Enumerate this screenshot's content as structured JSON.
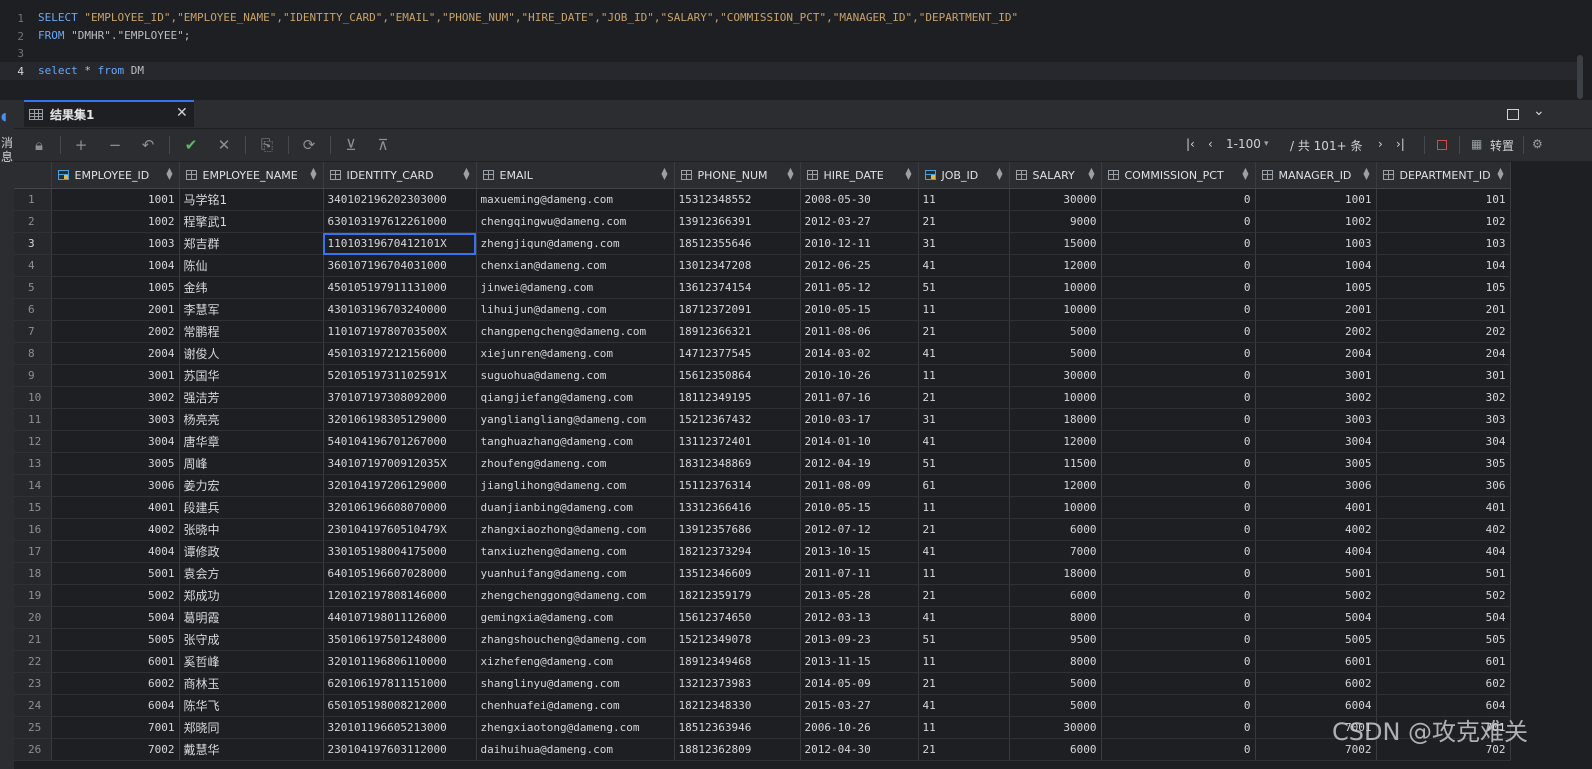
{
  "editor": {
    "lines": [
      {
        "n": "1",
        "parts": [
          {
            "t": "SELECT ",
            "c": "kw"
          },
          {
            "t": "\"EMPLOYEE_ID\",\"EMPLOYEE_NAME\",\"IDENTITY_CARD\",\"EMAIL\",\"PHONE_NUM\",\"HIRE_DATE\",\"JOB_ID\",\"SALARY\",\"COMMISSION_PCT\",\"MANAGER_ID\",\"DEPARTMENT_ID\"",
            "c": "str"
          }
        ]
      },
      {
        "n": "2",
        "parts": [
          {
            "t": "FROM ",
            "c": "kw"
          },
          {
            "t": "\"DMHR\".\"EMPLOYEE\";",
            "c": ""
          }
        ]
      },
      {
        "n": "3",
        "parts": []
      },
      {
        "n": "4",
        "parts": [
          {
            "t": "select",
            "c": "kw"
          },
          {
            "t": " * ",
            "c": ""
          },
          {
            "t": "from",
            "c": "kw"
          },
          {
            "t": " DM",
            "c": ""
          }
        ]
      }
    ]
  },
  "left_strip": {
    "label": "消息"
  },
  "result_tab": {
    "title": "结果集1"
  },
  "toolbar": {
    "page_range": "1-100",
    "total": "/ 共 101+ 条",
    "transpose_label": "转置"
  },
  "grid": {
    "columns": [
      "EMPLOYEE_ID",
      "EMPLOYEE_NAME",
      "IDENTITY_CARD",
      "EMAIL",
      "PHONE_NUM",
      "HIRE_DATE",
      "JOB_ID",
      "SALARY",
      "COMMISSION_PCT",
      "MANAGER_ID",
      "DEPARTMENT_ID"
    ],
    "rows": [
      [
        "1001",
        "马学铭1",
        "340102196202303000",
        "maxueming@dameng.com",
        "15312348552",
        "2008-05-30",
        "11",
        "30000",
        "0",
        "1001",
        "101"
      ],
      [
        "1002",
        "程擎武1",
        "630103197612261000",
        "chengqingwu@dameng.com",
        "13912366391",
        "2012-03-27",
        "21",
        "9000",
        "0",
        "1002",
        "102"
      ],
      [
        "1003",
        "郑吉群",
        "11010319670412101X",
        "zhengjiqun@dameng.com",
        "18512355646",
        "2010-12-11",
        "31",
        "15000",
        "0",
        "1003",
        "103"
      ],
      [
        "1004",
        "陈仙",
        "360107196704031000",
        "chenxian@dameng.com",
        "13012347208",
        "2012-06-25",
        "41",
        "12000",
        "0",
        "1004",
        "104"
      ],
      [
        "1005",
        "金纬",
        "450105197911131000",
        "jinwei@dameng.com",
        "13612374154",
        "2011-05-12",
        "51",
        "10000",
        "0",
        "1005",
        "105"
      ],
      [
        "2001",
        "李慧军",
        "430103196703240000",
        "lihuijun@dameng.com",
        "18712372091",
        "2010-05-15",
        "11",
        "10000",
        "0",
        "2001",
        "201"
      ],
      [
        "2002",
        "常鹏程",
        "11010719780703500X",
        "changpengcheng@dameng.com",
        "18912366321",
        "2011-08-06",
        "21",
        "5000",
        "0",
        "2002",
        "202"
      ],
      [
        "2004",
        "谢俊人",
        "450103197212156000",
        "xiejunren@dameng.com",
        "14712377545",
        "2014-03-02",
        "41",
        "5000",
        "0",
        "2004",
        "204"
      ],
      [
        "3001",
        "苏国华",
        "52010519731102591X",
        "suguohua@dameng.com",
        "15612350864",
        "2010-10-26",
        "11",
        "30000",
        "0",
        "3001",
        "301"
      ],
      [
        "3002",
        "强洁芳",
        "370107197308092000",
        "qiangjiefang@dameng.com",
        "18112349195",
        "2011-07-16",
        "21",
        "10000",
        "0",
        "3002",
        "302"
      ],
      [
        "3003",
        "杨亮亮",
        "320106198305129000",
        "yangliangliang@dameng.com",
        "15212367432",
        "2010-03-17",
        "31",
        "18000",
        "0",
        "3003",
        "303"
      ],
      [
        "3004",
        "唐华章",
        "540104196701267000",
        "tanghuazhang@dameng.com",
        "13112372401",
        "2014-01-10",
        "41",
        "12000",
        "0",
        "3004",
        "304"
      ],
      [
        "3005",
        "周峰",
        "34010719700912035X",
        "zhoufeng@dameng.com",
        "18312348869",
        "2012-04-19",
        "51",
        "11500",
        "0",
        "3005",
        "305"
      ],
      [
        "3006",
        "姜力宏",
        "320104197206129000",
        "jianglihong@dameng.com",
        "15112376314",
        "2011-08-09",
        "61",
        "12000",
        "0",
        "3006",
        "306"
      ],
      [
        "4001",
        "段建兵",
        "320106196608070000",
        "duanjianbing@dameng.com",
        "13312366416",
        "2010-05-15",
        "11",
        "10000",
        "0",
        "4001",
        "401"
      ],
      [
        "4002",
        "张晓中",
        "23010419760510479X",
        "zhangxiaozhong@dameng.com",
        "13912357686",
        "2012-07-12",
        "21",
        "6000",
        "0",
        "4002",
        "402"
      ],
      [
        "4004",
        "谭修政",
        "330105198004175000",
        "tanxiuzheng@dameng.com",
        "18212373294",
        "2013-10-15",
        "41",
        "7000",
        "0",
        "4004",
        "404"
      ],
      [
        "5001",
        "袁会方",
        "640105196607028000",
        "yuanhuifang@dameng.com",
        "13512346609",
        "2011-07-11",
        "11",
        "18000",
        "0",
        "5001",
        "501"
      ],
      [
        "5002",
        "郑成功",
        "120102197808146000",
        "zhengchenggong@dameng.com",
        "18212359179",
        "2013-05-28",
        "21",
        "6000",
        "0",
        "5002",
        "502"
      ],
      [
        "5004",
        "葛明霞",
        "440107198011126000",
        "gemingxia@dameng.com",
        "15612374650",
        "2012-03-13",
        "41",
        "8000",
        "0",
        "5004",
        "504"
      ],
      [
        "5005",
        "张守成",
        "350106197501248000",
        "zhangshoucheng@dameng.com",
        "15212349078",
        "2013-09-23",
        "51",
        "9500",
        "0",
        "5005",
        "505"
      ],
      [
        "6001",
        "奚哲峰",
        "320101196806110000",
        "xizhefeng@dameng.com",
        "18912349468",
        "2013-11-15",
        "11",
        "8000",
        "0",
        "6001",
        "601"
      ],
      [
        "6002",
        "商林玉",
        "620106197811151000",
        "shanglinyu@dameng.com",
        "13212373983",
        "2014-05-09",
        "21",
        "5000",
        "0",
        "6002",
        "602"
      ],
      [
        "6004",
        "陈华飞",
        "650105198008212000",
        "chenhuafei@dameng.com",
        "18212348330",
        "2015-03-27",
        "41",
        "5000",
        "0",
        "6004",
        "604"
      ],
      [
        "7001",
        "郑晓同",
        "320101196605213000",
        "zhengxiaotong@dameng.com",
        "18512363946",
        "2006-10-26",
        "11",
        "30000",
        "0",
        "7001",
        "701"
      ],
      [
        "7002",
        "戴慧华",
        "230104197603112000",
        "daihuihua@dameng.com",
        "18812362809",
        "2012-04-30",
        "21",
        "6000",
        "0",
        "7002",
        "702"
      ]
    ],
    "selected_row": 3,
    "selected_col": 2
  },
  "watermark": "CSDN @攻克难关"
}
